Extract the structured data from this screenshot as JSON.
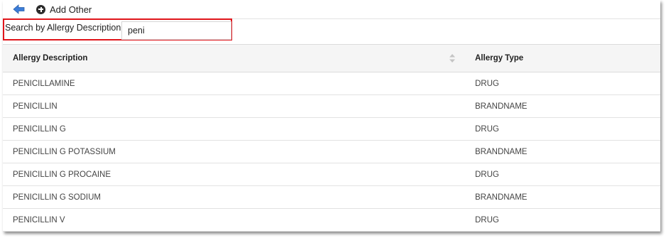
{
  "toolbar": {
    "back_icon": "left-arrow-icon",
    "add_other_label": "Add Other"
  },
  "search": {
    "label": "Search by Allergy Description",
    "value": "peni",
    "highlight_color": "#e0151b"
  },
  "table": {
    "columns": [
      "Allergy Description",
      "Allergy Type"
    ],
    "rows": [
      {
        "description": "PENICILLAMINE",
        "type": "DRUG"
      },
      {
        "description": "PENICILLIN",
        "type": "BRANDNAME"
      },
      {
        "description": "PENICILLIN G",
        "type": "DRUG"
      },
      {
        "description": "PENICILLIN G POTASSIUM",
        "type": "BRANDNAME"
      },
      {
        "description": "PENICILLIN G PROCAINE",
        "type": "DRUG"
      },
      {
        "description": "PENICILLIN G SODIUM",
        "type": "BRANDNAME"
      },
      {
        "description": "PENICILLIN V",
        "type": "DRUG"
      }
    ]
  }
}
